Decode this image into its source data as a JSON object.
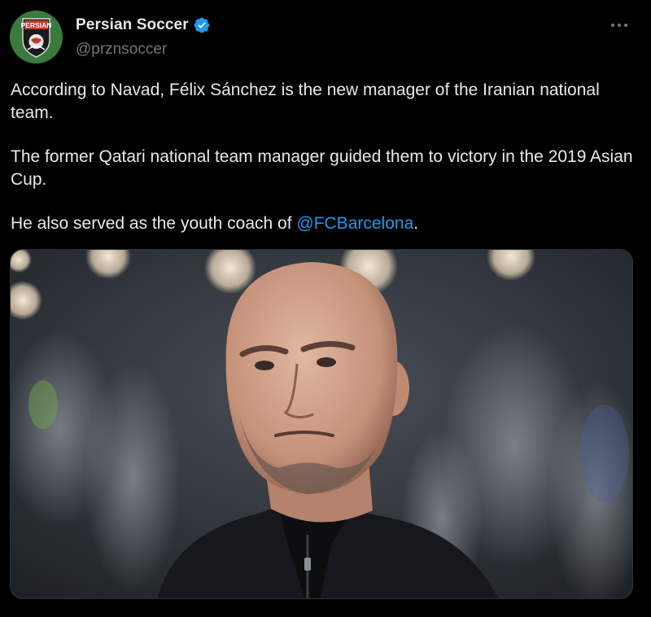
{
  "author": {
    "display_name": "Persian Soccer",
    "handle": "@prznsoccer",
    "avatar_text": "PERSIAN",
    "verified_icon": "verified-badge-icon"
  },
  "tweet": {
    "paragraphs": [
      "According to Navad, Félix Sánchez is the new manager of the Iranian national team.",
      "The former Qatari national team manager guided them to victory in the 2019 Asian Cup."
    ],
    "last_paragraph_prefix": "He also served as the youth coach of ",
    "mention": "@FCBarcelona",
    "last_paragraph_suffix": "."
  },
  "colors": {
    "background": "#000000",
    "text": "#e7e9ea",
    "secondary": "#71767b",
    "link": "#1d9bf0"
  }
}
